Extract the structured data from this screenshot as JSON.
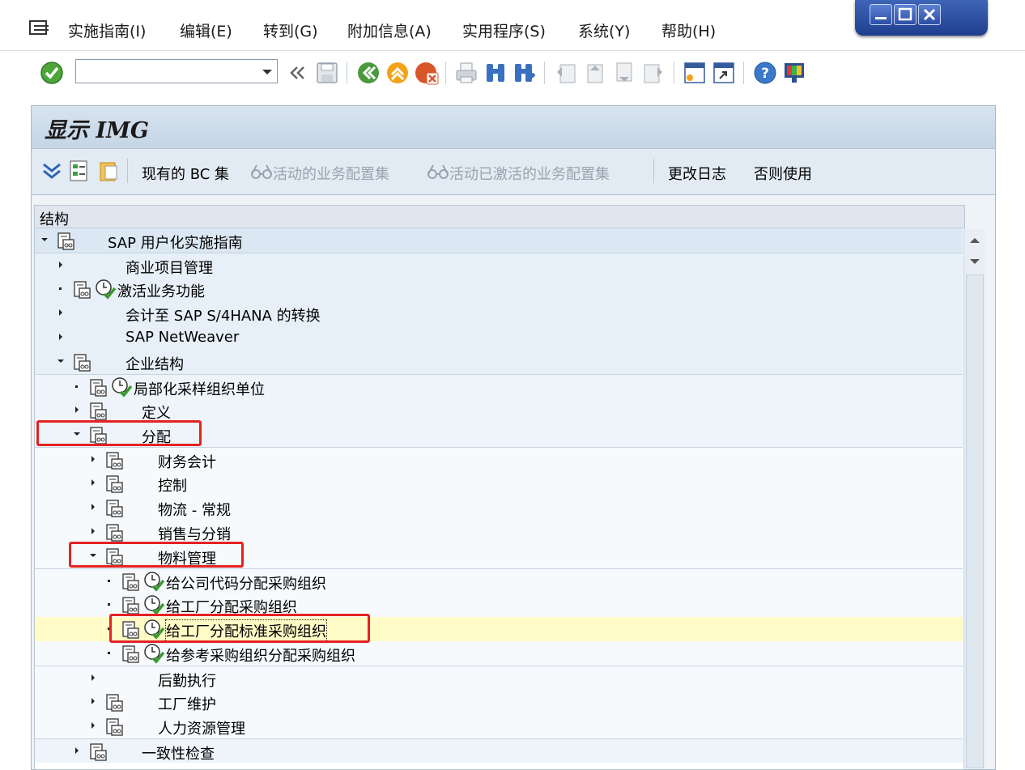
{
  "menubar": {
    "items": [
      "实施指南(I)",
      "编辑(E)",
      "转到(G)",
      "附加信息(A)",
      "实用程序(S)",
      "系统(Y)",
      "帮助(H)"
    ]
  },
  "window_controls": [
    "minimize-icon",
    "maximize-icon",
    "close-icon"
  ],
  "toolbar": {
    "command_field_value": "",
    "icons": [
      "enter-icon",
      "back-chevron-icon",
      "save-icon",
      "back-icon",
      "exit-icon",
      "cancel-icon",
      "print-icon",
      "find-icon",
      "find-next-icon",
      "first-page-icon",
      "prev-page-icon",
      "next-page-icon",
      "last-page-icon",
      "new-session-icon",
      "shortcut-icon",
      "help-icon",
      "customize-layout-icon"
    ]
  },
  "screen": {
    "title": "显示 IMG",
    "app_toolbar": {
      "bc_sets": "现有的 BC 集",
      "active_bc_sets": "活动的业务配置集",
      "activated_bc_sets": "活动已激活的业务配置集",
      "change_log": "更改日志",
      "release_notes": "否则使用"
    }
  },
  "tree": {
    "header": "结构",
    "rows": [
      {
        "label": "SAP 用户化实施指南",
        "level": 0,
        "state": "expanded"
      },
      {
        "label": "商业项目管理",
        "level": 1,
        "state": "collapsed"
      },
      {
        "label": "激活业务功能",
        "level": 1,
        "state": "leaf"
      },
      {
        "label": "会计至 SAP S/4HANA 的转换",
        "level": 1,
        "state": "collapsed"
      },
      {
        "label": "SAP NetWeaver",
        "level": 1,
        "state": "collapsed"
      },
      {
        "label": "企业结构",
        "level": 1,
        "state": "expanded"
      },
      {
        "label": "局部化采样组织单位",
        "level": 2,
        "state": "leaf"
      },
      {
        "label": "定义",
        "level": 2,
        "state": "collapsed"
      },
      {
        "label": "分配",
        "level": 2,
        "state": "expanded",
        "highlighted": true
      },
      {
        "label": "财务会计",
        "level": 3,
        "state": "collapsed"
      },
      {
        "label": "控制",
        "level": 3,
        "state": "collapsed"
      },
      {
        "label": "物流 - 常规",
        "level": 3,
        "state": "collapsed"
      },
      {
        "label": "销售与分销",
        "level": 3,
        "state": "collapsed"
      },
      {
        "label": "物料管理",
        "level": 3,
        "state": "expanded",
        "highlighted": true
      },
      {
        "label": "给公司代码分配采购组织",
        "level": 4,
        "state": "leaf"
      },
      {
        "label": "给工厂分配采购组织",
        "level": 4,
        "state": "leaf"
      },
      {
        "label": "给工厂分配标准采购组织",
        "level": 4,
        "state": "leaf",
        "selected": true,
        "highlighted": true
      },
      {
        "label": "给参考采购组织分配采购组织",
        "level": 4,
        "state": "leaf"
      },
      {
        "label": "后勤执行",
        "level": 3,
        "state": "collapsed"
      },
      {
        "label": "工厂维护",
        "level": 3,
        "state": "collapsed"
      },
      {
        "label": "人力资源管理",
        "level": 3,
        "state": "collapsed"
      },
      {
        "label": "一致性检查",
        "level": 2,
        "state": "collapsed"
      }
    ]
  },
  "colors": {
    "highlight_box": "#e52222",
    "selected_row": "#fffbc6",
    "title_bar": "#c5d5e5"
  }
}
